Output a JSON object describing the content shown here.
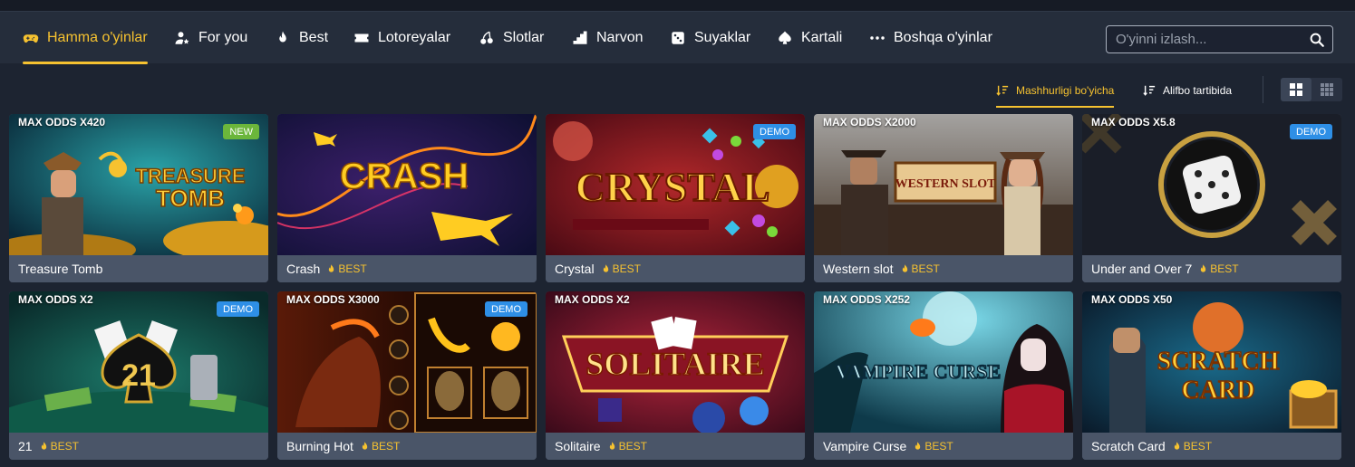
{
  "nav": {
    "items": [
      {
        "label": "Hamma o'yinlar",
        "icon": "gamepad-icon"
      },
      {
        "label": "For you",
        "icon": "user-star-icon"
      },
      {
        "label": "Best",
        "icon": "flame-icon"
      },
      {
        "label": "Lotoreyalar",
        "icon": "ticket-icon"
      },
      {
        "label": "Slotlar",
        "icon": "cherry-icon"
      },
      {
        "label": "Narvon",
        "icon": "stairs-icon"
      },
      {
        "label": "Suyaklar",
        "icon": "dice-icon"
      },
      {
        "label": "Kartali",
        "icon": "spade-icon"
      },
      {
        "label": "Boshqa o'yinlar",
        "icon": "dots-icon"
      }
    ]
  },
  "search": {
    "placeholder": "O'yinni izlash..."
  },
  "sort": {
    "popularity": "Mashhurligi bo'yicha",
    "alphabet": "Alifbo tartibida"
  },
  "best_label": "BEST",
  "games": [
    {
      "name": "Treasure Tomb",
      "odds": "MAX ODDS X420",
      "badge": "NEW",
      "best": false,
      "title_art": "TREASURE TOMB"
    },
    {
      "name": "Crash",
      "odds": "",
      "badge": "",
      "best": true,
      "title_art": "CRASH"
    },
    {
      "name": "Crystal",
      "odds": "",
      "badge": "DEMO",
      "best": true,
      "title_art": "CRYSTAL"
    },
    {
      "name": "Western slot",
      "odds": "MAX ODDS X2000",
      "badge": "",
      "best": true,
      "title_art": "WESTERN SLOT"
    },
    {
      "name": "Under and Over 7",
      "odds": "MAX ODDS X5.8",
      "badge": "DEMO",
      "best": true,
      "title_art": ""
    },
    {
      "name": "21",
      "odds": "MAX ODDS X2",
      "badge": "DEMO",
      "best": true,
      "title_art": "21"
    },
    {
      "name": "Burning Hot",
      "odds": "MAX ODDS X3000",
      "badge": "DEMO",
      "best": true,
      "title_art": ""
    },
    {
      "name": "Solitaire",
      "odds": "MAX ODDS X2",
      "badge": "",
      "best": true,
      "title_art": "SOLITAIRE"
    },
    {
      "name": "Vampire Curse",
      "odds": "MAX ODDS X252",
      "badge": "",
      "best": true,
      "title_art": "VAMPIRE CURSE"
    },
    {
      "name": "Scratch Card",
      "odds": "MAX ODDS X50",
      "badge": "",
      "best": true,
      "title_art": "SCRATCH CARD"
    }
  ],
  "colors": {
    "accent": "#f6c230",
    "nav_bg": "#252d3b",
    "page_bg": "#1d2431",
    "caption_bg": "#4a5568",
    "new_badge": "#6bb63b",
    "demo_badge": "#2e8fe6"
  }
}
